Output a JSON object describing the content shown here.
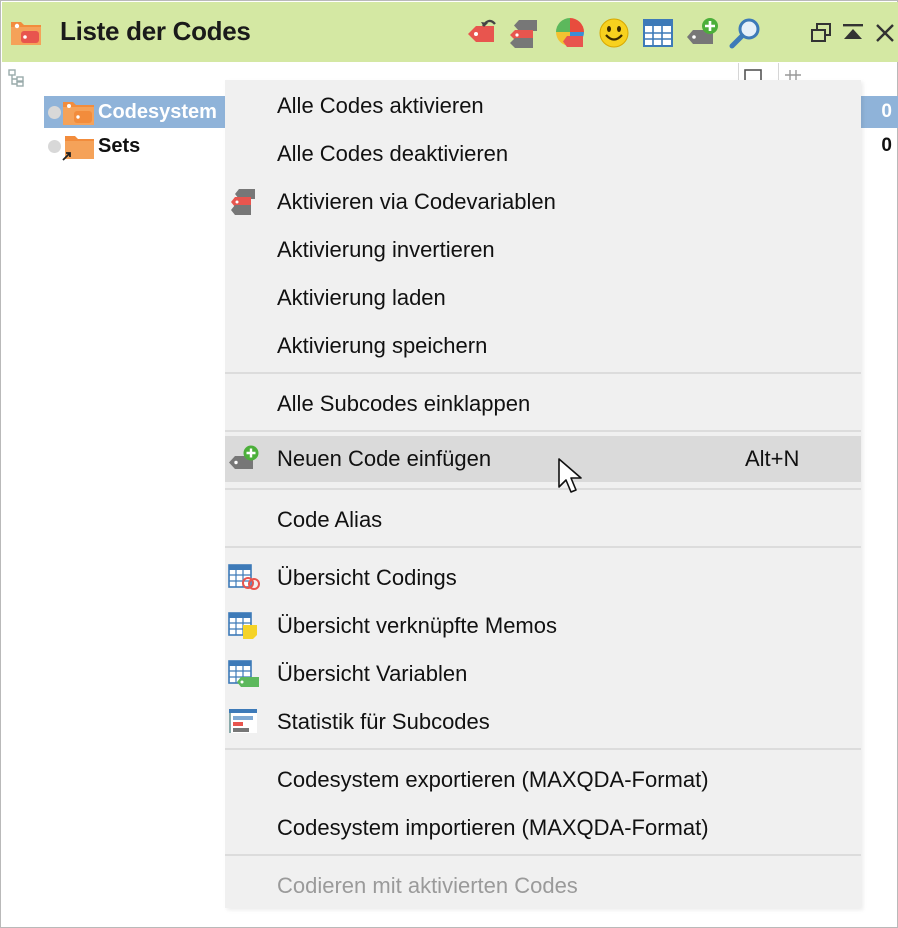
{
  "window": {
    "title": "Liste der Codes",
    "toolbar_icons": [
      "undo-code-icon",
      "code-variables-icon",
      "code-color-icon",
      "smiley-icon",
      "code-matrix-icon",
      "new-code-icon",
      "search-icon"
    ],
    "window_controls": [
      "undock-icon",
      "collapse-icon",
      "close-icon"
    ]
  },
  "tree": {
    "items": [
      {
        "label": "Codesystem",
        "count": "0",
        "selected": true
      },
      {
        "label": "Sets",
        "count": "0",
        "selected": false
      }
    ]
  },
  "context_menu": {
    "items": [
      {
        "label": "Alle Codes aktivieren"
      },
      {
        "label": "Alle Codes deaktivieren"
      },
      {
        "label": "Aktivieren via Codevariablen",
        "icon": "code-variables-icon"
      },
      {
        "label": "Aktivierung invertieren"
      },
      {
        "label": "Aktivierung laden"
      },
      {
        "label": "Aktivierung speichern"
      },
      {
        "label": "Alle Subcodes einklappen"
      },
      {
        "label": "Neuen Code einfügen",
        "shortcut": "Alt+N",
        "icon": "new-code-icon",
        "hovered": true
      },
      {
        "label": "Code Alias"
      },
      {
        "label": "Übersicht Codings",
        "icon": "overview-codings-icon"
      },
      {
        "label": "Übersicht verknüpfte Memos",
        "icon": "overview-memos-icon"
      },
      {
        "label": "Übersicht Variablen",
        "icon": "overview-variables-icon"
      },
      {
        "label": "Statistik für Subcodes",
        "icon": "statistics-icon"
      },
      {
        "label": "Codesystem exportieren (MAXQDA-Format)"
      },
      {
        "label": "Codesystem importieren (MAXQDA-Format)"
      },
      {
        "label": "Codieren mit aktivierten Codes",
        "disabled": true
      }
    ]
  },
  "colors": {
    "titlebar": "#d4e8a3",
    "selection": "#8fb3d9",
    "menu_bg": "#f0f0f0",
    "hover": "#dadada",
    "code_orange": "#f28c3c",
    "code_red": "#e8554e"
  }
}
